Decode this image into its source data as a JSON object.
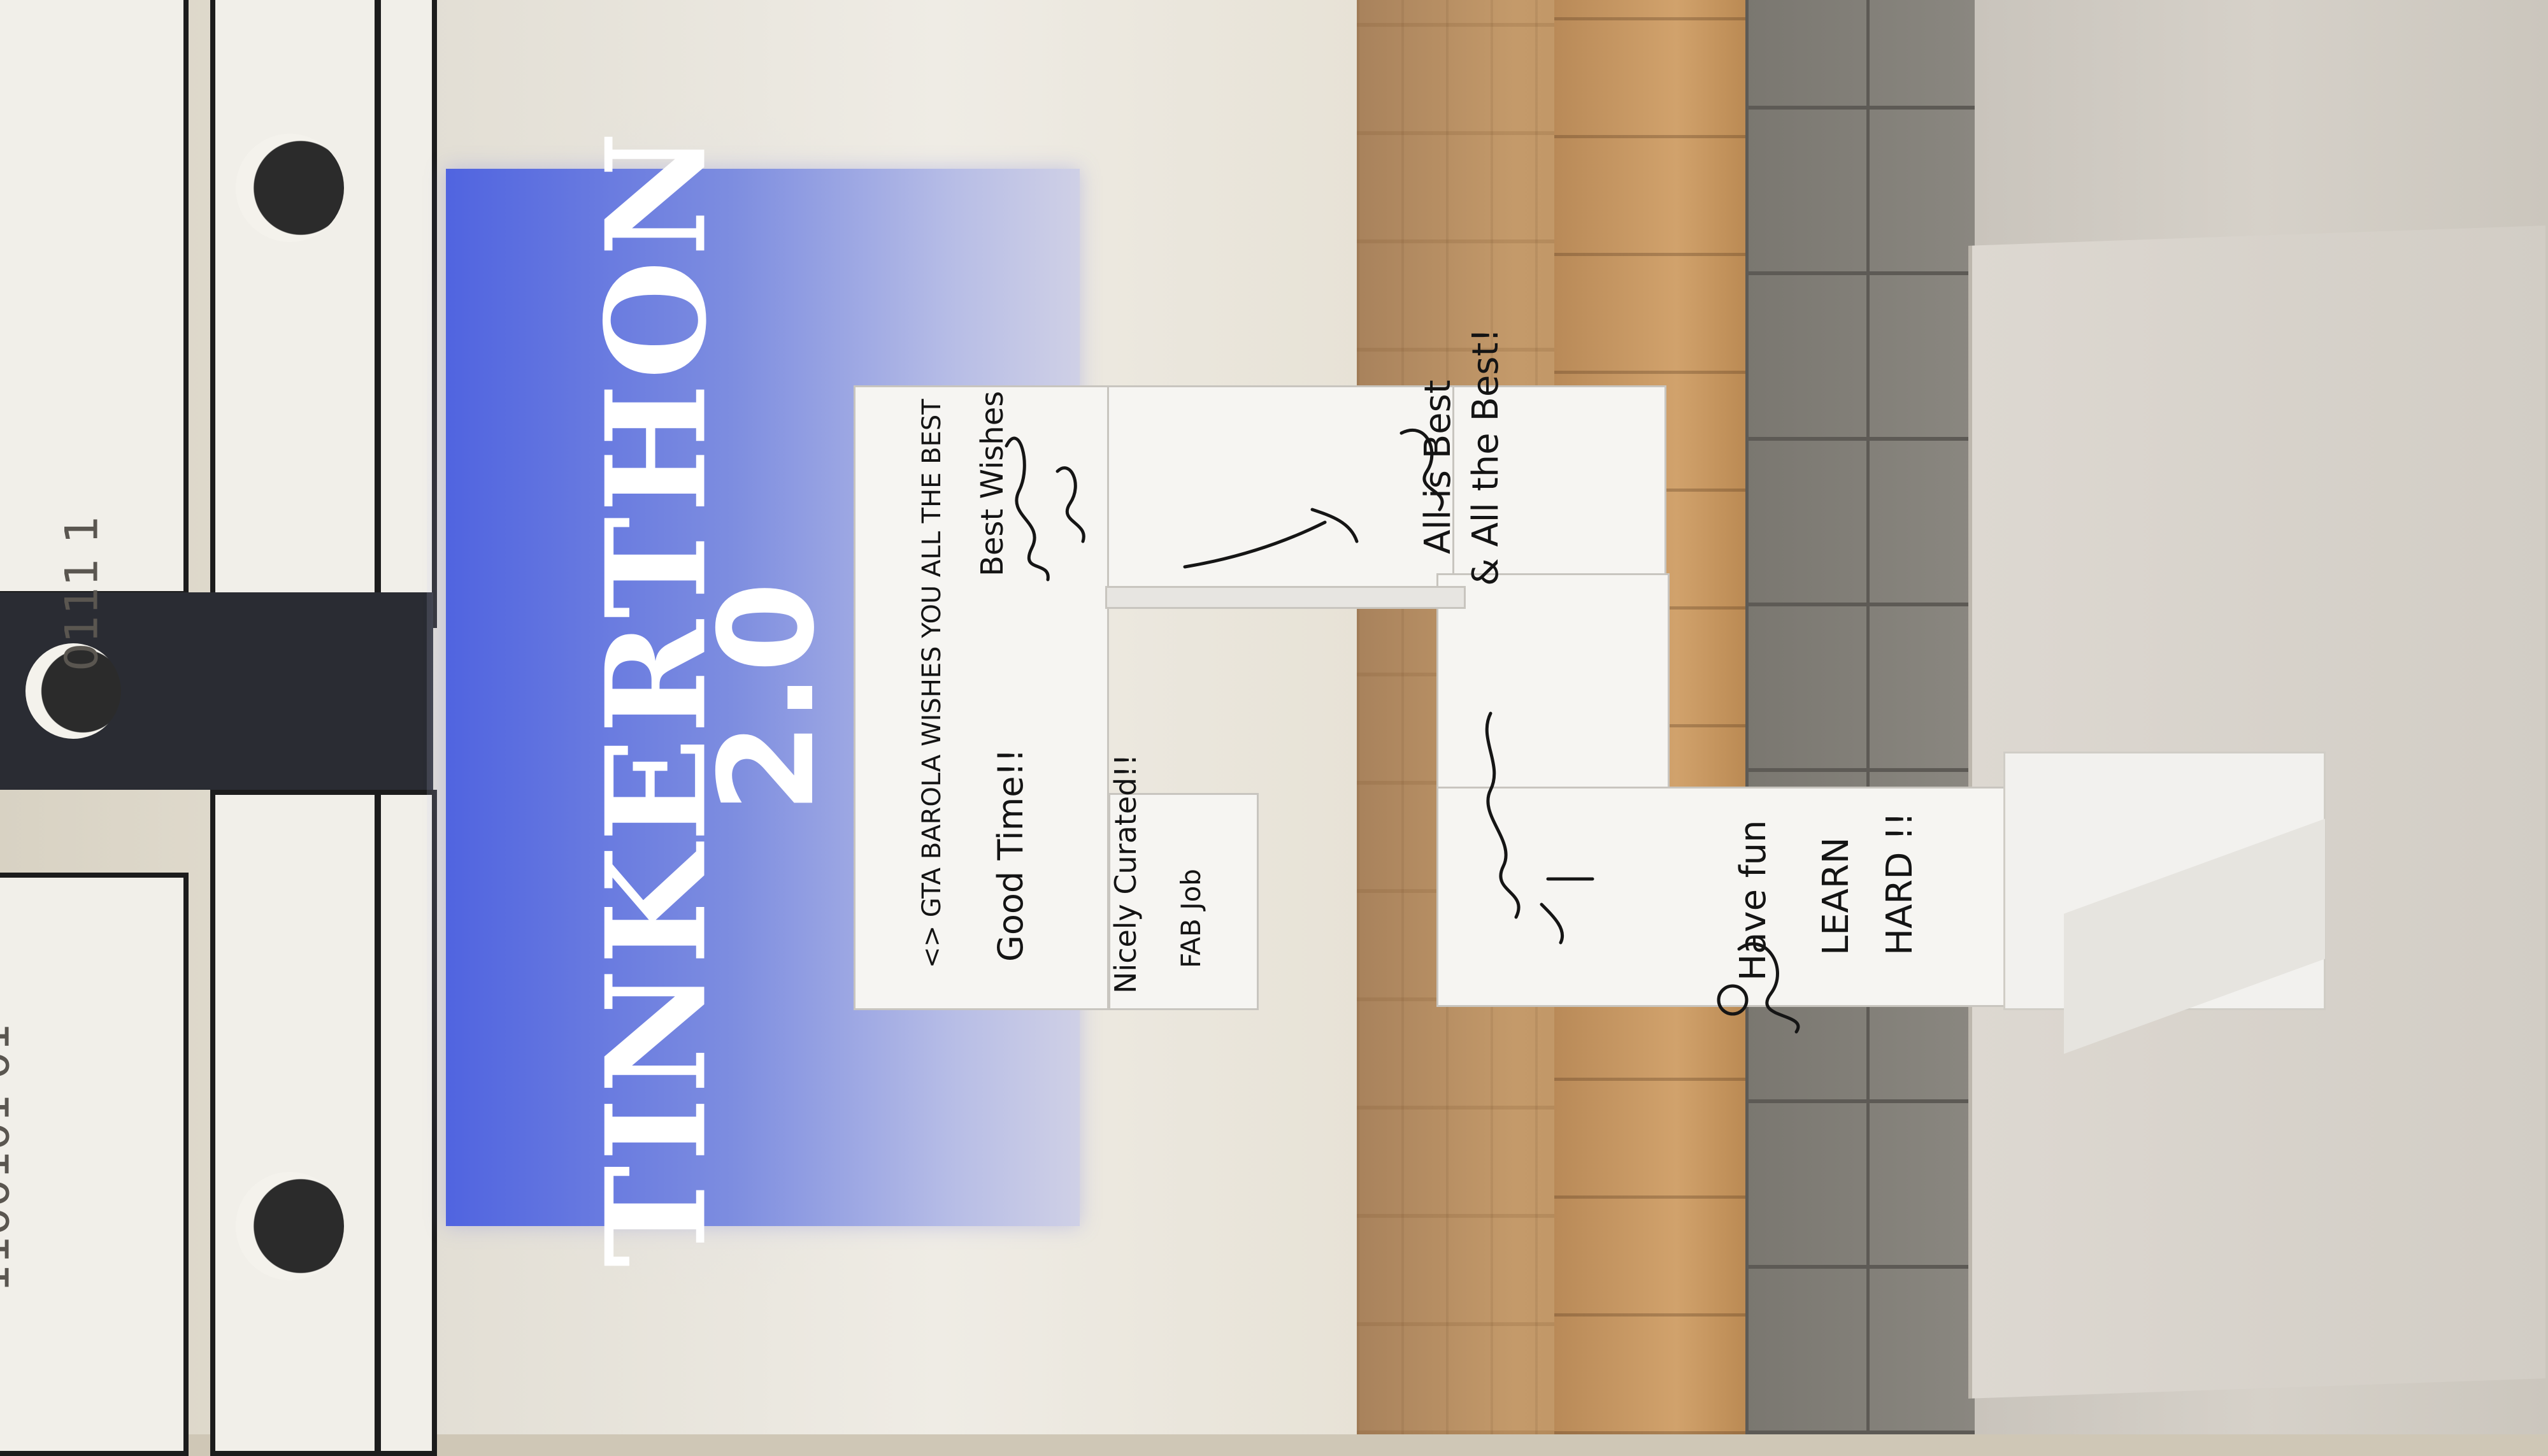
{
  "screen": {
    "title": "TINKERTHON",
    "version": "2.0"
  },
  "garland": {
    "top_text": "0111 1",
    "bottom_text": "1100101 01"
  },
  "sculpture": {
    "messages": [
      "<> GTA BAROLA WISHES YOU ALL THE BEST",
      "Good Time!!",
      "Best Wishes",
      "Nicely Curated!!",
      "FAB Job",
      "All is Best",
      "& All the Best!",
      "Have fun",
      "LEARN",
      "HARD !!"
    ]
  }
}
